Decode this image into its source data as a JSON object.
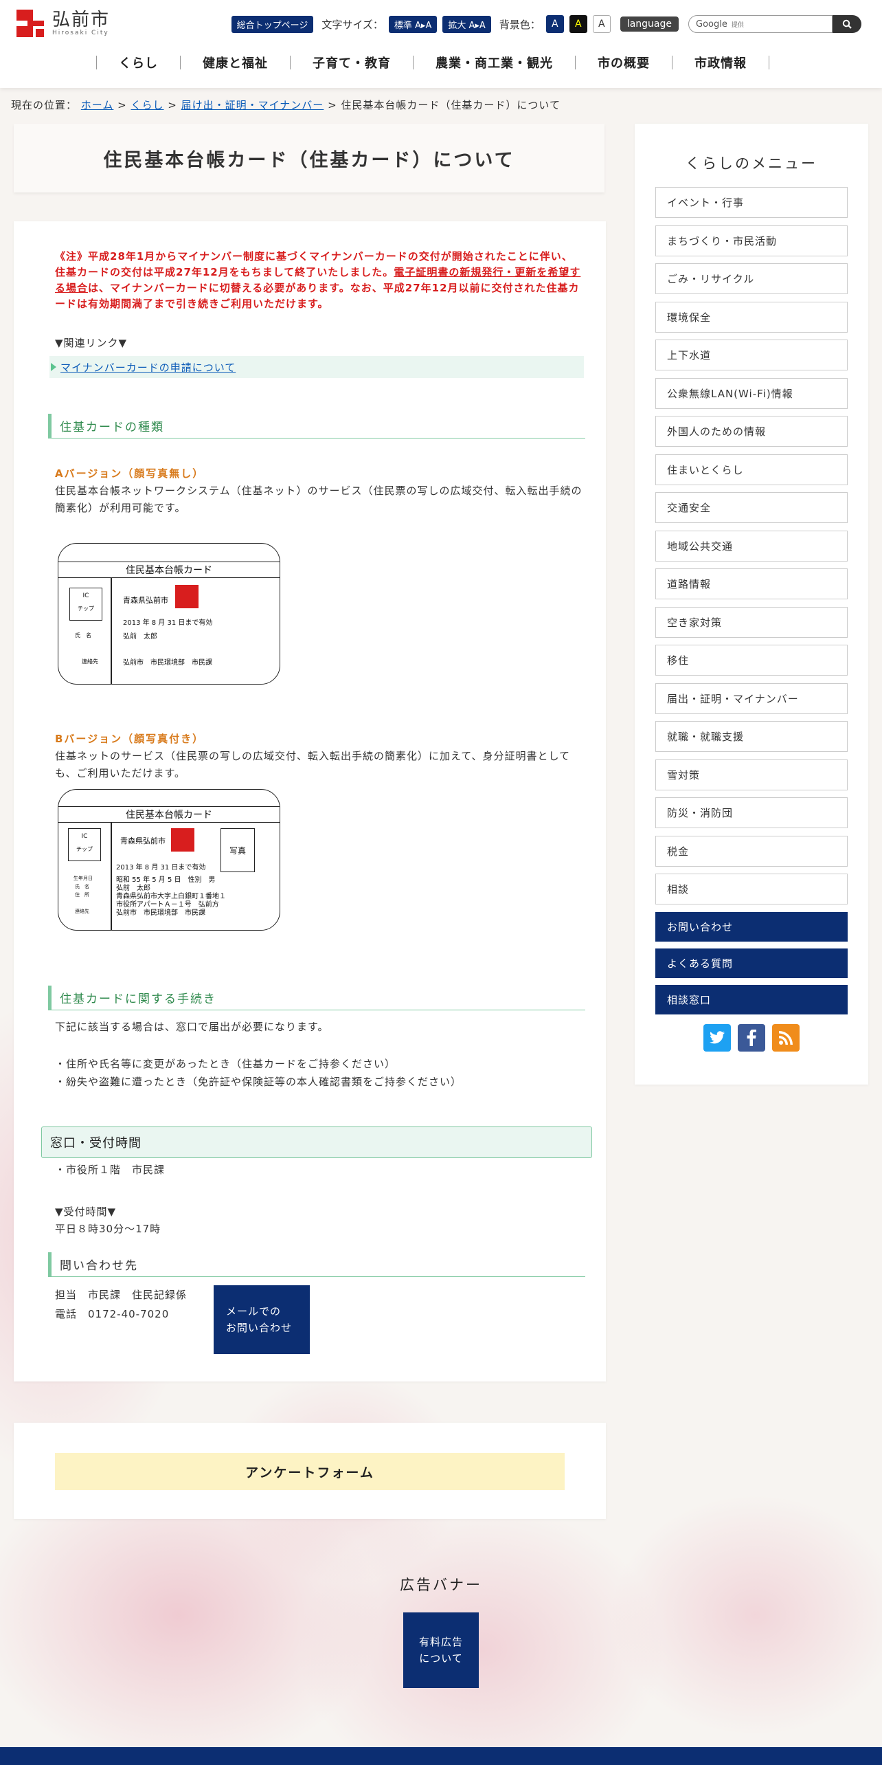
{
  "header": {
    "logo_name": "弘前市",
    "logo_sub": "Hirosaki City",
    "top_page_label": "総合トップページ",
    "font_size_label": "文字サイズ：",
    "font_standard": "標準 A▸A",
    "font_large": "拡大 A▸A",
    "bg_color_label": "背景色：",
    "bg_options": [
      "A",
      "A",
      "A"
    ],
    "language_label": "language",
    "search_placeholder": "Google",
    "search_provided": "提供"
  },
  "gnav": [
    "くらし",
    "健康と福祉",
    "子育て・教育",
    "農業・商工業・観光",
    "市の概要",
    "市政情報"
  ],
  "breadcrumb": {
    "label": "現在の位置：",
    "items": [
      "ホーム",
      "くらし",
      "届け出・証明・マイナンバー"
    ],
    "current": "住民基本台帳カード（住基カード）について"
  },
  "page_title": "住民基本台帳カード（住基カード）について",
  "notice": {
    "text1": "《注》平成28年1月からマイナンバー制度に基づくマイナンバーカードの交付が開始されたことに伴い、住基カードの交付は平成27年12月をもちまして終了いたしました。",
    "underline": "電子証明書の新規発行・更新を希望する場合",
    "text2": "は、マイナンバーカードに切替える必要があります。なお、平成27年12月以前に交付された住基カードは有効期間満了まで引き続きご利用いただけます。"
  },
  "related_links": {
    "toggle": "▼関連リンク▼",
    "items": [
      "マイナンバーカードの申請について"
    ]
  },
  "section_types": {
    "heading": "住基カードの種類",
    "a_title": "Aバージョン（顔写真無し）",
    "a_desc": "住民基本台帳ネットワークシステム（住基ネット）のサービス（住民票の写しの広域交付、転入転出手続の簡素化）が利用可能です。",
    "b_title": "Bバージョン（顔写真付き）",
    "b_desc": "住基ネットのサービス（住民票の写しの広域交付、転入転出手続の簡素化）に加えて、身分証明書としても、ご利用いただけます。"
  },
  "card_a": {
    "title": "住民基本台帳カード",
    "ic1": "IC",
    "ic2": "チップ",
    "issuer": "青森県弘前市",
    "valid": "2013 年 8 月 31 日まで有効",
    "name_label": "氏　名",
    "name": "弘前　太郎",
    "contact_label": "連絡先",
    "contact": "弘前市　市民環境部　市民課"
  },
  "card_b": {
    "title": "住民基本台帳カード",
    "ic1": "IC",
    "ic2": "チップ",
    "issuer": "青森県弘前市",
    "photo": "写真",
    "valid": "2013 年 8 月 31 日まで有効",
    "birth_label": "生年月日",
    "birth": "昭和 55 年 5 月 5 日　性別　男",
    "name_label": "氏　名",
    "name": "弘前　太郎",
    "addr_label": "住　所",
    "addr1": "青森県弘前市大字上白銀町１番地１",
    "addr2": "市役所アパートＡ－１号　弘前方",
    "contact_label": "連絡先",
    "contact": "弘前市　市民環境部　市民課"
  },
  "section_procedures": {
    "heading": "住基カードに関する手続き",
    "intro": "下記に該当する場合は、窓口で届出が必要になります。",
    "items": [
      "・住所や氏名等に変更があったとき（住基カードをご持参ください）",
      "・紛失や盗難に遭ったとき（免許証や保険証等の本人確認書類をご持参ください）"
    ]
  },
  "window": {
    "heading": "窓口・受付時間",
    "place": "・市役所１階　市民課",
    "toggle": "▼受付時間▼",
    "hours": "平日８時30分～17時"
  },
  "contact": {
    "heading": "問い合わせ先",
    "charge": "担当　市民課　住民記録係",
    "phone": "電話　0172-40-7020",
    "mail_button_1": "メールでの",
    "mail_button_2": "お問い合わせ"
  },
  "survey": {
    "label": "アンケートフォーム"
  },
  "ad": {
    "title": "広告バナー",
    "button_1": "有料広告",
    "button_2": "について"
  },
  "sidebar": {
    "title": "くらしのメニュー",
    "items": [
      "イベント・行事",
      "まちづくり・市民活動",
      "ごみ・リサイクル",
      "環境保全",
      "上下水道",
      "公衆無線LAN(Wi-Fi)情報",
      "外国人のための情報",
      "住まいとくらし",
      "交通安全",
      "地域公共交通",
      "道路情報",
      "空き家対策",
      "移住",
      "届出・証明・マイナンバー",
      "就職・就職支援",
      "雪対策",
      "防災・消防団",
      "税金",
      "相談"
    ],
    "navy_items": [
      "お問い合わせ",
      "よくある質問",
      "相談窓口"
    ],
    "sns": [
      "twitter-icon",
      "facebook-icon",
      "rss-icon"
    ]
  },
  "colors": {
    "navy": "#0c2e72",
    "red": "#d81e1e",
    "green": "#7fc9a1",
    "orange": "#d87a1b",
    "link": "#0b5bb8"
  }
}
